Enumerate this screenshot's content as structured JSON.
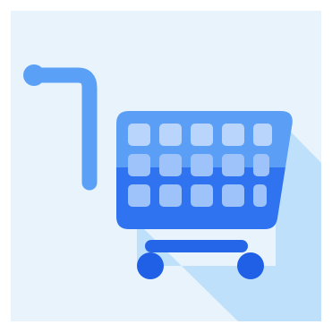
{
  "icon": {
    "name": "shopping-cart-icon",
    "style": "flat icon with long shadow"
  },
  "colors": {
    "page_background": "#ffffff",
    "tile_background": "#e8f3fb",
    "long_shadow": "#bfe0fa",
    "handle": "#5aa0f6",
    "basket_top": "#5b9ef6",
    "basket_bottom": "#2f73f0",
    "grid_cell_top": "#b9d5fb",
    "grid_cell_bottom": "#9ec3fa",
    "base_bar": "#2566e8",
    "wheel": "#1f60e6"
  },
  "basket_grid": {
    "rows": 3,
    "columns": 5
  }
}
